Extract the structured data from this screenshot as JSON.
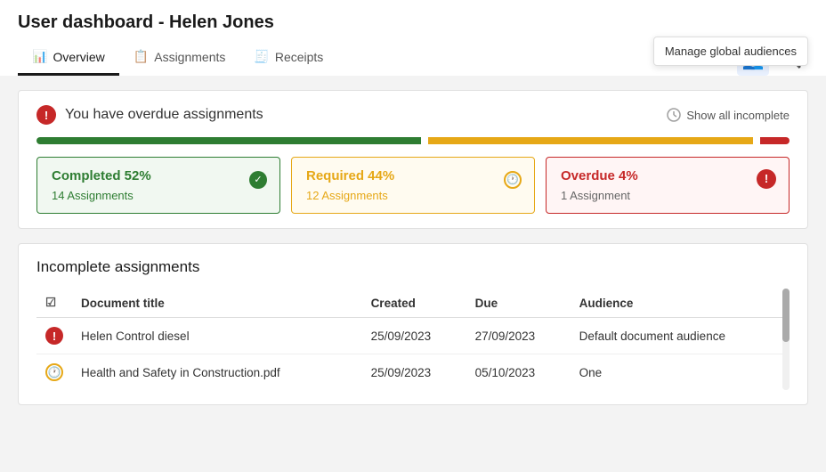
{
  "page": {
    "title": "User dashboard - Helen Jones",
    "tooltip": "Manage global audiences"
  },
  "nav": {
    "tabs": [
      {
        "id": "overview",
        "label": "Overview",
        "icon": "📊",
        "active": true
      },
      {
        "id": "assignments",
        "label": "Assignments",
        "icon": "📋",
        "active": false
      },
      {
        "id": "receipts",
        "label": "Receipts",
        "icon": "🧾",
        "active": false
      }
    ]
  },
  "overdue_banner": {
    "title": "You have overdue assignments",
    "show_all_label": "Show all incomplete"
  },
  "progress": {
    "green_pct": 52,
    "orange_pct": 44,
    "red_pct": 4
  },
  "stats": [
    {
      "id": "completed",
      "title": "Completed 52%",
      "subtitle": "14 Assignments",
      "type": "green",
      "icon": "✔"
    },
    {
      "id": "required",
      "title": "Required 44%",
      "subtitle": "12 Assignments",
      "type": "orange",
      "icon": "🕐"
    },
    {
      "id": "overdue",
      "title": "Overdue 4%",
      "subtitle": "1 Assignment",
      "type": "red",
      "icon": "!"
    }
  ],
  "incomplete_section": {
    "title": "Incomplete assignments",
    "columns": [
      "",
      "Document title",
      "Created",
      "Due",
      "Audience"
    ],
    "rows": [
      {
        "status": "overdue",
        "document_title": "Helen Control diesel",
        "created": "25/09/2023",
        "due": "27/09/2023",
        "audience": "Default document audience"
      },
      {
        "status": "required",
        "document_title": "Health and Safety in Construction.pdf",
        "created": "25/09/2023",
        "due": "05/10/2023",
        "audience": "One"
      }
    ]
  }
}
